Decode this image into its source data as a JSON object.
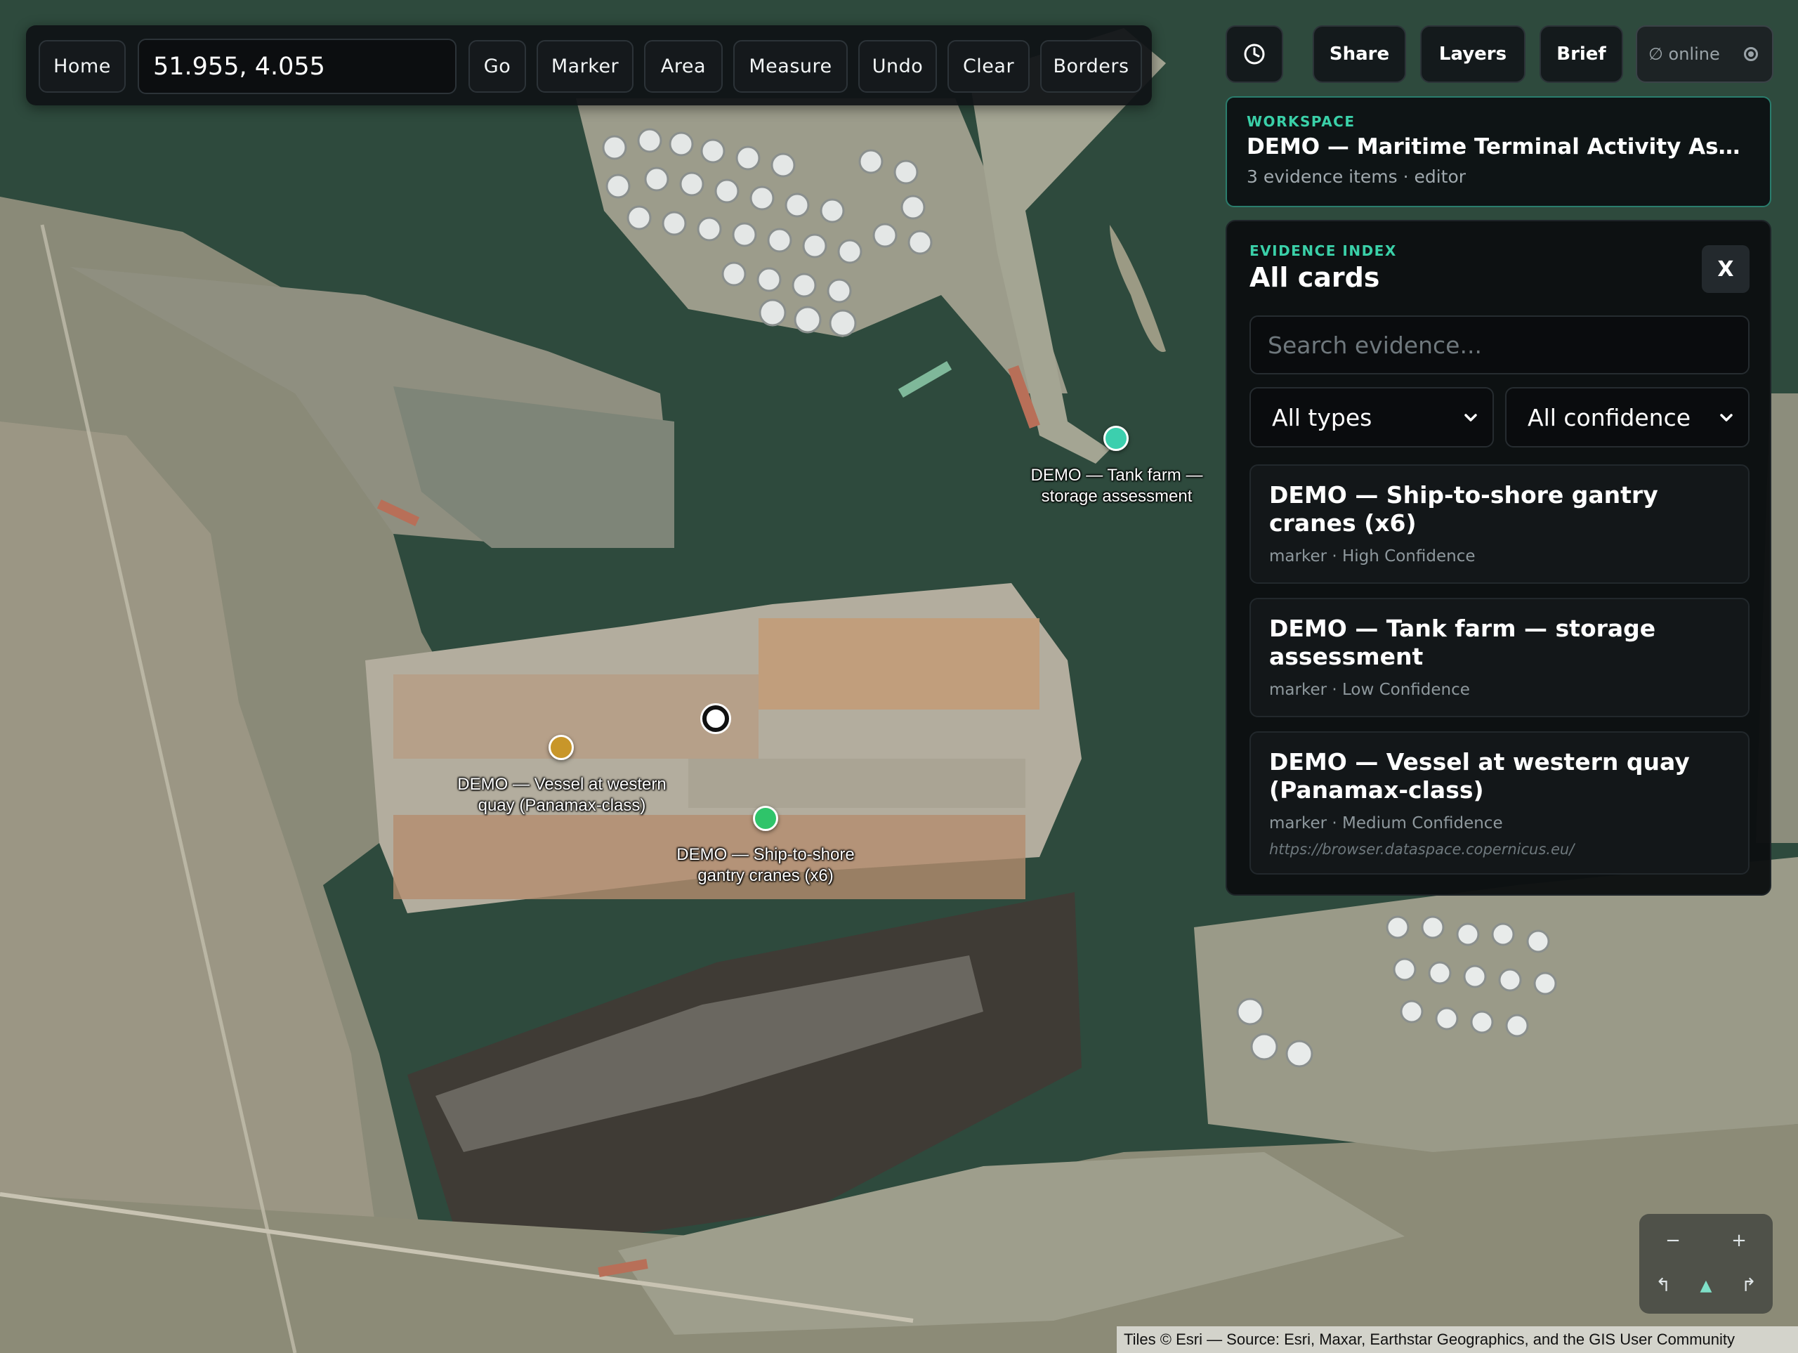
{
  "toolbar": {
    "home_label": "Home",
    "coord_value": "51.955, 4.055",
    "go_label": "Go",
    "marker_label": "Marker",
    "area_label": "Area",
    "measure_label": "Measure",
    "undo_label": "Undo",
    "clear_label": "Clear",
    "borders_label": "Borders"
  },
  "topright": {
    "history_icon": "clock-icon",
    "share_label": "Share",
    "layers_label": "Layers",
    "brief_label": "Brief",
    "status_text": "∅ online"
  },
  "workspace": {
    "kicker": "WORKSPACE",
    "title": "DEMO — Maritime Terminal Activity Assess...",
    "subtitle": "3 evidence items · editor"
  },
  "evidence": {
    "kicker": "EVIDENCE INDEX",
    "title": "All cards",
    "close_label": "X",
    "search_placeholder": "Search evidence...",
    "type_filter": "All types",
    "confidence_filter": "All confidence",
    "cards": [
      {
        "title": "DEMO — Ship-to-shore gantry cranes (x6)",
        "meta": "marker · High Confidence",
        "link": ""
      },
      {
        "title": "DEMO — Tank farm — storage assessment",
        "meta": "marker · Low Confidence",
        "link": ""
      },
      {
        "title": "DEMO — Vessel at western quay (Panamax-class)",
        "meta": "marker · Medium Confidence",
        "link": "https://browser.dataspace.copernicus.eu/"
      }
    ]
  },
  "map_markers": [
    {
      "label_line1": "DEMO — Tank farm —",
      "label_line2": "storage assessment",
      "color": "#3ccfae"
    },
    {
      "label_line1": "DEMO — Vessel at western",
      "label_line2": "quay (Panamax-class)",
      "color": "#c8962a"
    },
    {
      "label_line1": "DEMO — Ship-to-shore",
      "label_line2": "gantry cranes (x6)",
      "color": "#2fc46a"
    }
  ],
  "map_controls": {
    "zoom_out": "−",
    "zoom_in": "+",
    "rotate_left": "↰",
    "north": "▲",
    "rotate_right": "↱"
  },
  "attribution": "Tiles © Esri — Source: Esri, Maxar, Earthstar Geographics, and the GIS User Community",
  "colors": {
    "accent": "#3ad0a8",
    "water": "#2f4a3c",
    "panel_bg": "#0c0f11"
  }
}
